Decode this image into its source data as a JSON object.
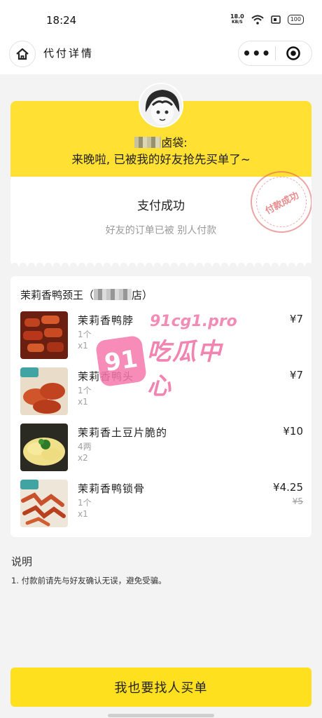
{
  "status_bar": {
    "time": "18:24",
    "net_speed_value": "18.0",
    "net_speed_unit": "KB/S",
    "battery": "100"
  },
  "nav": {
    "title": "代付详情",
    "home_icon": "home-icon",
    "more_icon": "more-dots-icon",
    "close_icon": "target-circle-icon"
  },
  "header": {
    "friend_name_suffix": "卤袋:",
    "friend_message": "来晚啦, 已被我的好友抢先买单了~",
    "status_title": "支付成功",
    "status_note": "好友的订单已被 别人付款",
    "stamp_text": "付款成功",
    "accent_color": "#ffe033"
  },
  "order": {
    "shop_name_prefix": "茉莉香鸭颈王（",
    "shop_name_suffix": "店）",
    "items": [
      {
        "name": "茉莉香鸭脖",
        "spec": "1个",
        "qty": "x1",
        "price": "¥7",
        "original_price": ""
      },
      {
        "name": "茉莉香鸭头",
        "spec": "1个",
        "qty": "x1",
        "price": "¥7",
        "original_price": ""
      },
      {
        "name": "茉莉香土豆片脆的",
        "spec": "4两",
        "qty": "x2",
        "price": "¥10",
        "original_price": ""
      },
      {
        "name": "茉莉香鸭锁骨",
        "spec": "1个",
        "qty": "x1",
        "price": "¥4.25",
        "original_price": "¥5"
      }
    ]
  },
  "watermark": {
    "url": "91cg1.pro",
    "badge": "91",
    "name": "吃瓜中心"
  },
  "notes": {
    "title": "说明",
    "items": [
      "1. 付款前请先与好友确认无误，避免受骗。"
    ]
  },
  "cta": {
    "label": "我也要找人买单",
    "color": "#ffe01f"
  }
}
